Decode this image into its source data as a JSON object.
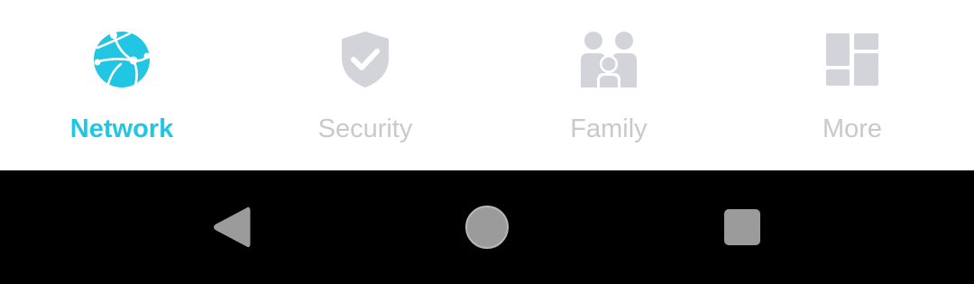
{
  "tabs": [
    {
      "label": "Network",
      "icon": "globe-network-icon",
      "active": true
    },
    {
      "label": "Security",
      "icon": "shield-check-icon",
      "active": false
    },
    {
      "label": "Family",
      "icon": "family-icon",
      "active": false
    },
    {
      "label": "More",
      "icon": "grid-more-icon",
      "active": false
    }
  ],
  "colors": {
    "active": "#21c6e2",
    "inactive": "#c8c9cf",
    "navbar_bg": "#000000",
    "nav_button": "#9b9b9b"
  },
  "system_nav": {
    "buttons": [
      "back-icon",
      "home-icon",
      "recents-icon"
    ]
  }
}
